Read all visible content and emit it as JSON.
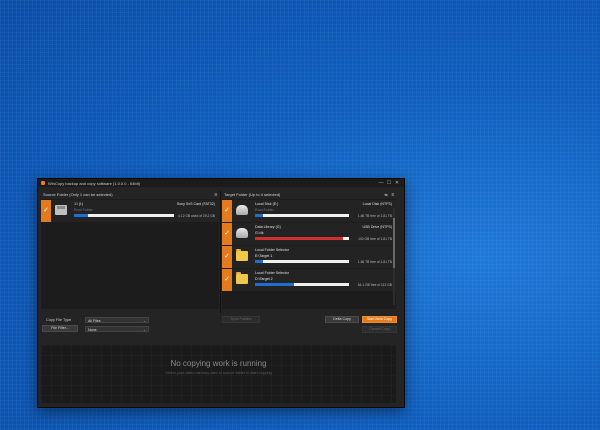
{
  "window": {
    "title": "WinCopy backup and copy software (1.0.0.0 - 64bit)",
    "controls": [
      "—",
      "☐",
      "✕"
    ]
  },
  "source": {
    "header": "Source Folder (Only 1 can be selected)",
    "items": [
      {
        "name": "J:\\ (I:)",
        "device": "Sony SxS Card (FAT32)",
        "path": "Root Folder",
        "used": "4.12 GB used of 29.2 GB",
        "fill": 0.14,
        "checked": true
      }
    ]
  },
  "target": {
    "header": "Target Folder (Up to 4 selected)",
    "items": [
      {
        "name": "Local Disk (E:)",
        "device": "Local Disk (NTFS)",
        "path": "Root Folder",
        "free": "1.66 TB free of 1.81 TB",
        "fill": 0.08,
        "checked": true,
        "icon": "drive-icon"
      },
      {
        "name": "Data Library (G)",
        "device": "USB Drive (NTFS)",
        "path": "G:\\4k",
        "free": "100 GB free of 1.81 TB",
        "fill": 0.94,
        "checked": true,
        "icon": "drive-icon",
        "red": true
      },
      {
        "name": "Local Folder Selector",
        "device": "",
        "path": "E:\\Target 1",
        "free": "1.66 TB free of 1.81 TB",
        "fill": 0.08,
        "checked": true,
        "icon": "folder-icon"
      },
      {
        "name": "Local Folder Selector",
        "device": "",
        "path": "D:\\Target 2",
        "free": "64.1 GB free of 112 GB",
        "fill": 0.42,
        "checked": true,
        "icon": "folder-icon"
      }
    ]
  },
  "controls": {
    "copy_file_type_label": "Copy File Type",
    "copy_file_type_value": "All Files",
    "file_filter_label": "File Filter...",
    "file_filter_value": "None",
    "sync_folders": "Sync Folders",
    "delta_copy": "Delta Copy",
    "start_new_copy": "Start New Copy",
    "cancel_copy": "Cancel Copy"
  },
  "work": {
    "title": "No copying work is running",
    "subtitle": "Select your video memory card or source folder to start copying"
  },
  "colors": {
    "accent": "#e37b1e",
    "bar_blue": "#1e6fd0",
    "bar_red": "#d03030"
  }
}
